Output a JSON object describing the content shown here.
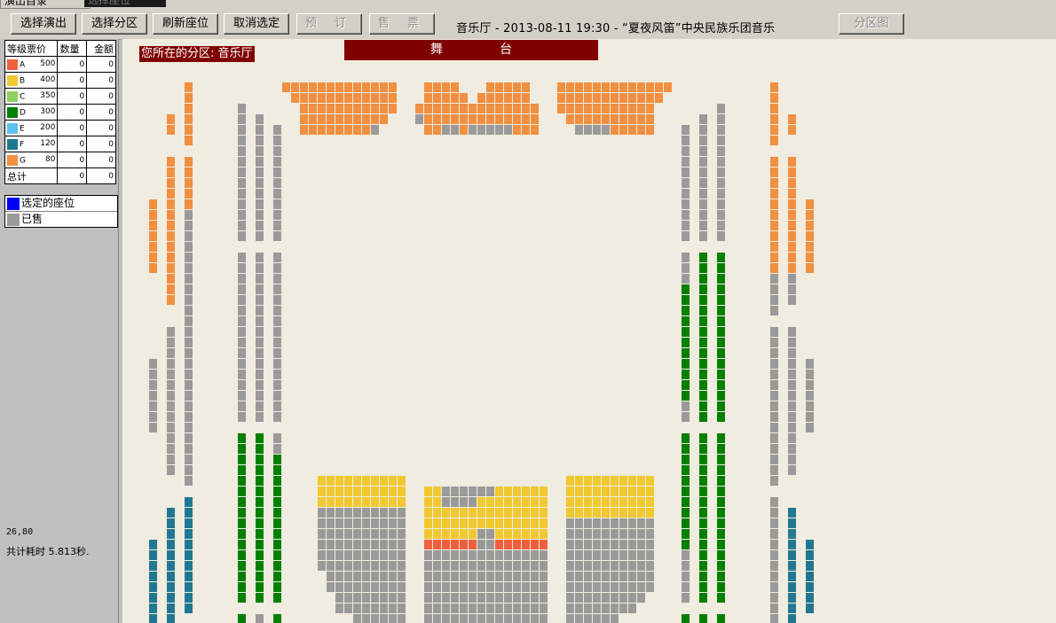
{
  "tabs": [
    {
      "label": "演出目录"
    },
    {
      "label": "选择座位"
    }
  ],
  "toolbar": {
    "select_show": "选择演出",
    "select_zone": "选择分区",
    "refresh": "刷新座位",
    "cancel_selection": "取消选定",
    "reserve": "预 订",
    "sell": "售 票",
    "zone_map": "分区图",
    "performance_title": "音乐厅 - 2013-08-11 19:30 - “夏夜风笛”中央民族乐团音乐"
  },
  "price_table": {
    "headers": [
      "等级票价",
      "数量",
      "金额"
    ],
    "rows": [
      {
        "grade": "A",
        "price": "500",
        "qty": "0",
        "amount": "0",
        "color": "#f06040"
      },
      {
        "grade": "B",
        "price": "400",
        "qty": "0",
        "amount": "0",
        "color": "#f0c830"
      },
      {
        "grade": "C",
        "price": "350",
        "qty": "0",
        "amount": "0",
        "color": "#90d060"
      },
      {
        "grade": "D",
        "price": "300",
        "qty": "0",
        "amount": "0",
        "color": "#008000"
      },
      {
        "grade": "E",
        "price": "200",
        "qty": "0",
        "amount": "0",
        "color": "#60c0f0"
      },
      {
        "grade": "F",
        "price": "120",
        "qty": "0",
        "amount": "0",
        "color": "#207890"
      },
      {
        "grade": "G",
        "price": "80",
        "qty": "0",
        "amount": "0",
        "color": "#f09040"
      }
    ],
    "total": {
      "label": "总计",
      "qty": "0",
      "amount": "0"
    }
  },
  "legend": [
    {
      "label": "选定的座位",
      "color": "#0000ff"
    },
    {
      "label": "已售",
      "color": "#9a9a9a"
    }
  ],
  "status": {
    "coordinates": "26,80",
    "timing": "共计耗时 5.813秒."
  },
  "seatmap": {
    "zone_label": "您所在的分区: 音乐厅",
    "stage_label": "舞台",
    "colors": {
      "sold": "#9a9a9a",
      "G": "#f09040",
      "D": "#008000",
      "F": "#207890",
      "B": "#f0c830",
      "A": "#f06040",
      "background": "#f0ece0"
    }
  }
}
